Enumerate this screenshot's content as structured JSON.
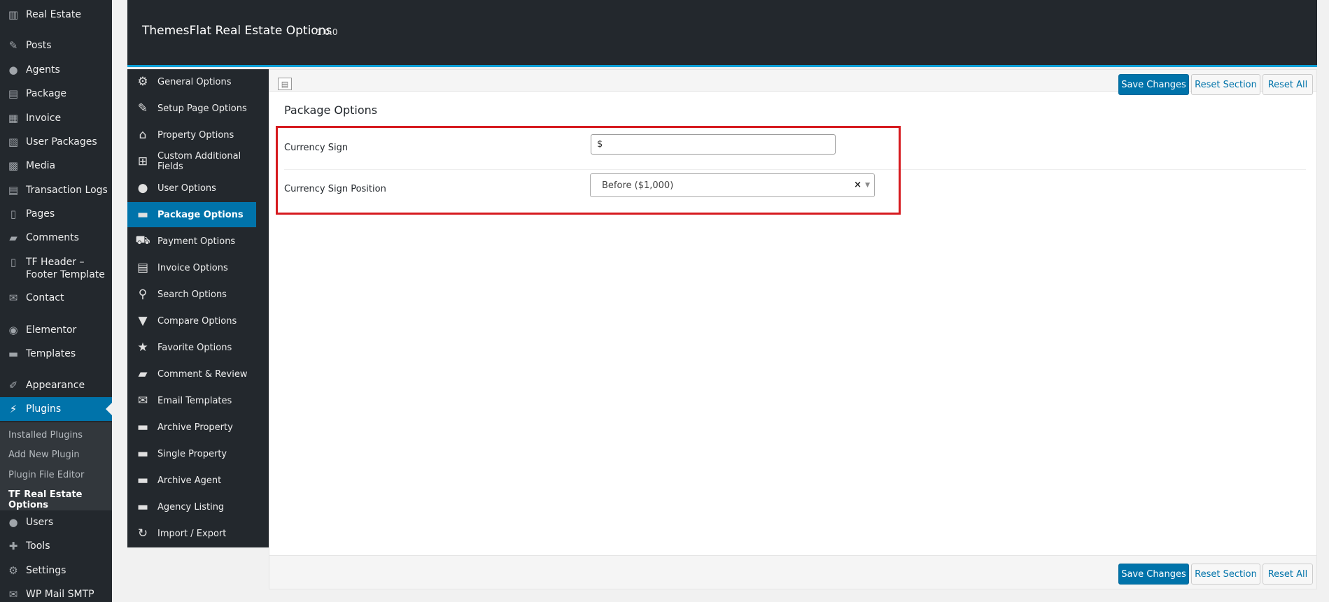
{
  "wp_menu": {
    "items": [
      {
        "label": "Real Estate",
        "icon": "building-icon"
      },
      {
        "label": "Posts",
        "icon": "pin-icon"
      },
      {
        "label": "Agents",
        "icon": "user-icon"
      },
      {
        "label": "Package",
        "icon": "package-icon"
      },
      {
        "label": "Invoice",
        "icon": "invoice-icon"
      },
      {
        "label": "User Packages",
        "icon": "user-packages-icon"
      },
      {
        "label": "Media",
        "icon": "media-icon"
      },
      {
        "label": "Transaction Logs",
        "icon": "logs-icon"
      },
      {
        "label": "Pages",
        "icon": "pages-icon"
      },
      {
        "label": "Comments",
        "icon": "comment-icon"
      },
      {
        "label": "TF Header – Footer Template",
        "icon": "template-icon"
      },
      {
        "label": "Contact",
        "icon": "mail-icon"
      },
      {
        "label": "Elementor",
        "icon": "elementor-icon"
      },
      {
        "label": "Templates",
        "icon": "folder-icon"
      },
      {
        "label": "Appearance",
        "icon": "brush-icon"
      },
      {
        "label": "Plugins",
        "icon": "plug-icon"
      },
      {
        "label": "Users",
        "icon": "user-icon"
      },
      {
        "label": "Tools",
        "icon": "wrench-icon"
      },
      {
        "label": "Settings",
        "icon": "settings-icon"
      },
      {
        "label": "WP Mail SMTP",
        "icon": "mail-icon"
      }
    ],
    "plugins_submenu": [
      "Installed Plugins",
      "Add New Plugin",
      "Plugin File Editor",
      "TF Real Estate Options"
    ]
  },
  "header": {
    "title": "ThemesFlat Real Estate Options",
    "version": "1.0.0"
  },
  "options_menu": [
    {
      "label": "General Options",
      "icon": "gear-icon"
    },
    {
      "label": "Setup Page Options",
      "icon": "wrench-icon"
    },
    {
      "label": "Property Options",
      "icon": "home-icon"
    },
    {
      "label": "Custom Additional Fields",
      "icon": "add-file-icon"
    },
    {
      "label": "User Options",
      "icon": "user-icon"
    },
    {
      "label": "Package Options",
      "icon": "folder-icon"
    },
    {
      "label": "Payment Options",
      "icon": "cart-icon"
    },
    {
      "label": "Invoice Options",
      "icon": "clipboard-icon"
    },
    {
      "label": "Search Options",
      "icon": "search-icon"
    },
    {
      "label": "Compare Options",
      "icon": "filter-icon"
    },
    {
      "label": "Favorite Options",
      "icon": "star-icon"
    },
    {
      "label": "Comment & Review",
      "icon": "comment-icon"
    },
    {
      "label": "Email Templates",
      "icon": "mail-icon"
    },
    {
      "label": "Archive Property",
      "icon": "folder-icon"
    },
    {
      "label": "Single Property",
      "icon": "folder-icon"
    },
    {
      "label": "Archive Agent",
      "icon": "folder-icon"
    },
    {
      "label": "Agency Listing",
      "icon": "folder-icon"
    },
    {
      "label": "Import / Export",
      "icon": "refresh-icon"
    }
  ],
  "toolbar": {
    "save_label": "Save Changes",
    "reset_section_label": "Reset Section",
    "reset_all_label": "Reset All"
  },
  "section": {
    "title": "Package Options",
    "currency_sign_label": "Currency Sign",
    "currency_sign_value": "$",
    "currency_position_label": "Currency Sign Position",
    "currency_position_value": "Before ($1,000)",
    "clear_glyph": "×"
  },
  "colors": {
    "accent": "#0073aa",
    "highlight_border": "#d61a1f",
    "header_bg": "#23282d"
  }
}
